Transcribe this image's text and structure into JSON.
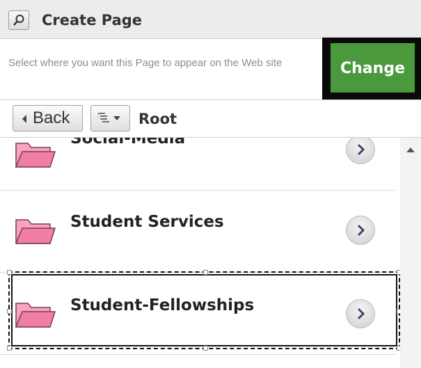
{
  "header": {
    "title": "Create Page",
    "search_icon": "search-icon"
  },
  "info": {
    "instruction": "Select where you want this Page to appear on the Web site",
    "change_label": "Change"
  },
  "nav": {
    "back_label": "Back",
    "tree_icon": "tree-view-dropdown-icon",
    "crumb": "Root"
  },
  "folders": [
    {
      "name": "Social-Media",
      "icon": "folder-icon"
    },
    {
      "name": "Student Services",
      "icon": "folder-icon"
    },
    {
      "name": "Student-Fellowships",
      "icon": "folder-icon",
      "selected": true
    }
  ],
  "colors": {
    "change_button": "#4a9a3d",
    "folder": "#f07ea6"
  }
}
